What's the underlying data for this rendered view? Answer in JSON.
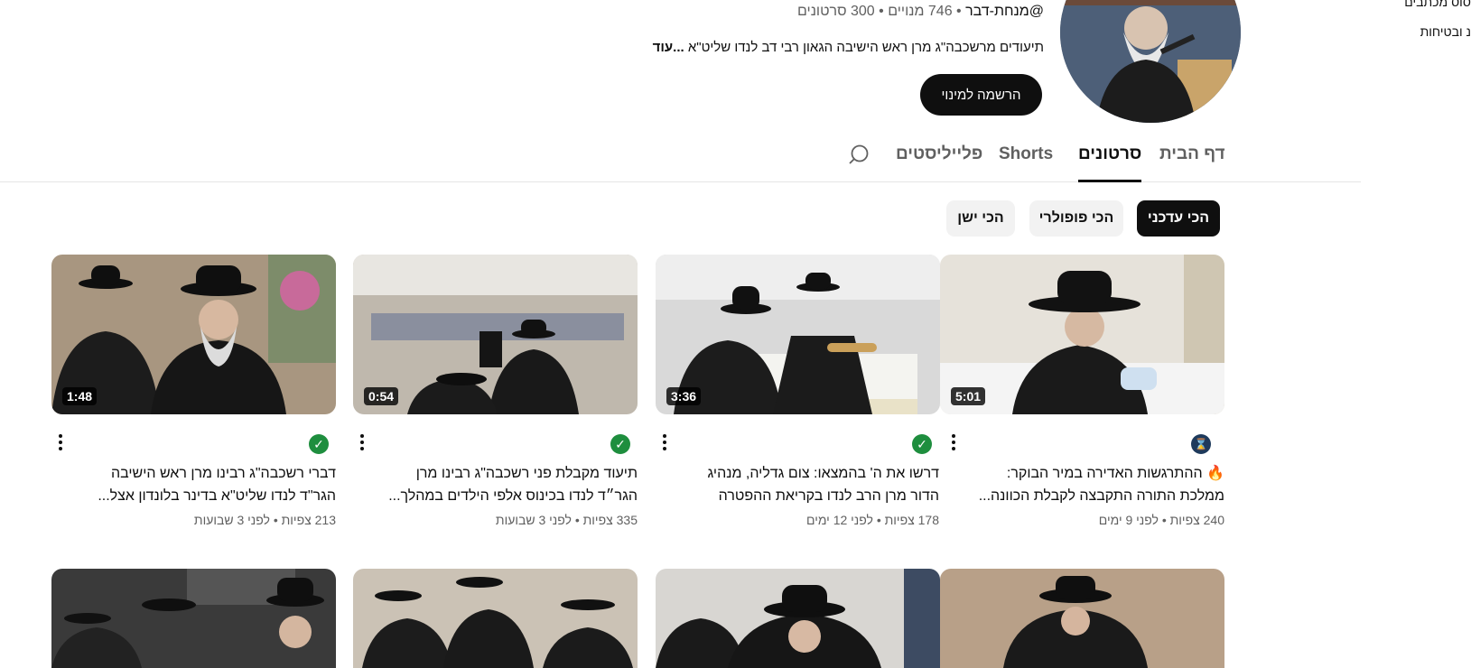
{
  "sidebar_stub": {
    "line1": "סוס מכתבים",
    "line2": "נ ובטיחות"
  },
  "channel": {
    "handle": "@מנחת-דבר",
    "subscribers": "746 מנויים",
    "video_count": "300 סרטונים",
    "separator": "•",
    "description": "תיעודים מרשכבה\"ג מרן ראש הישיבה הגאון רבי דב לנדו שליט\"א",
    "more_label": "...עוד",
    "subscribe_label": "הרשמה למינוי"
  },
  "tabs": [
    {
      "label": "דף הבית",
      "active": false
    },
    {
      "label": "סרטונים",
      "active": true
    },
    {
      "label": "Shorts",
      "active": false
    },
    {
      "label": "פלייליסטים",
      "active": false
    }
  ],
  "chips": [
    {
      "label": "הכי עדכני",
      "selected": true
    },
    {
      "label": "הכי פופולרי",
      "selected": false
    },
    {
      "label": "הכי ישן",
      "selected": false
    }
  ],
  "videos": [
    {
      "duration": "5:01",
      "badge": "hourglass-icon",
      "title": "🔥 ההתרגשות האדירה במיר הבוקר: ממלכת התורה התקבצה לקבלת הכוונה...",
      "views": "240 צפיות",
      "age": "לפני 9 ימים"
    },
    {
      "duration": "3:36",
      "badge": "check-icon",
      "title": "דרשו את ה' בהמצאו: צום גדליה, מנהיג הדור מרן הרב לנדו בקריאת ההפטרה",
      "views": "178 צפיות",
      "age": "לפני 12 ימים"
    },
    {
      "duration": "0:54",
      "badge": "check-icon",
      "title": "תיעוד מקבלת פני רשכבה\"ג רבינו מרן הגר״ד לנדו בכינוס אלפי הילדים במהלך...",
      "views": "335 צפיות",
      "age": "לפני 3 שבועות"
    },
    {
      "duration": "1:48",
      "badge": "check-icon",
      "title": "דברי רשכבה\"ג רבינו מרן ראש הישיבה הגר\"ד לנדו שליט\"א בדינר בלונדון אצל...",
      "views": "213 צפיות",
      "age": "לפני 3 שבועות"
    }
  ]
}
